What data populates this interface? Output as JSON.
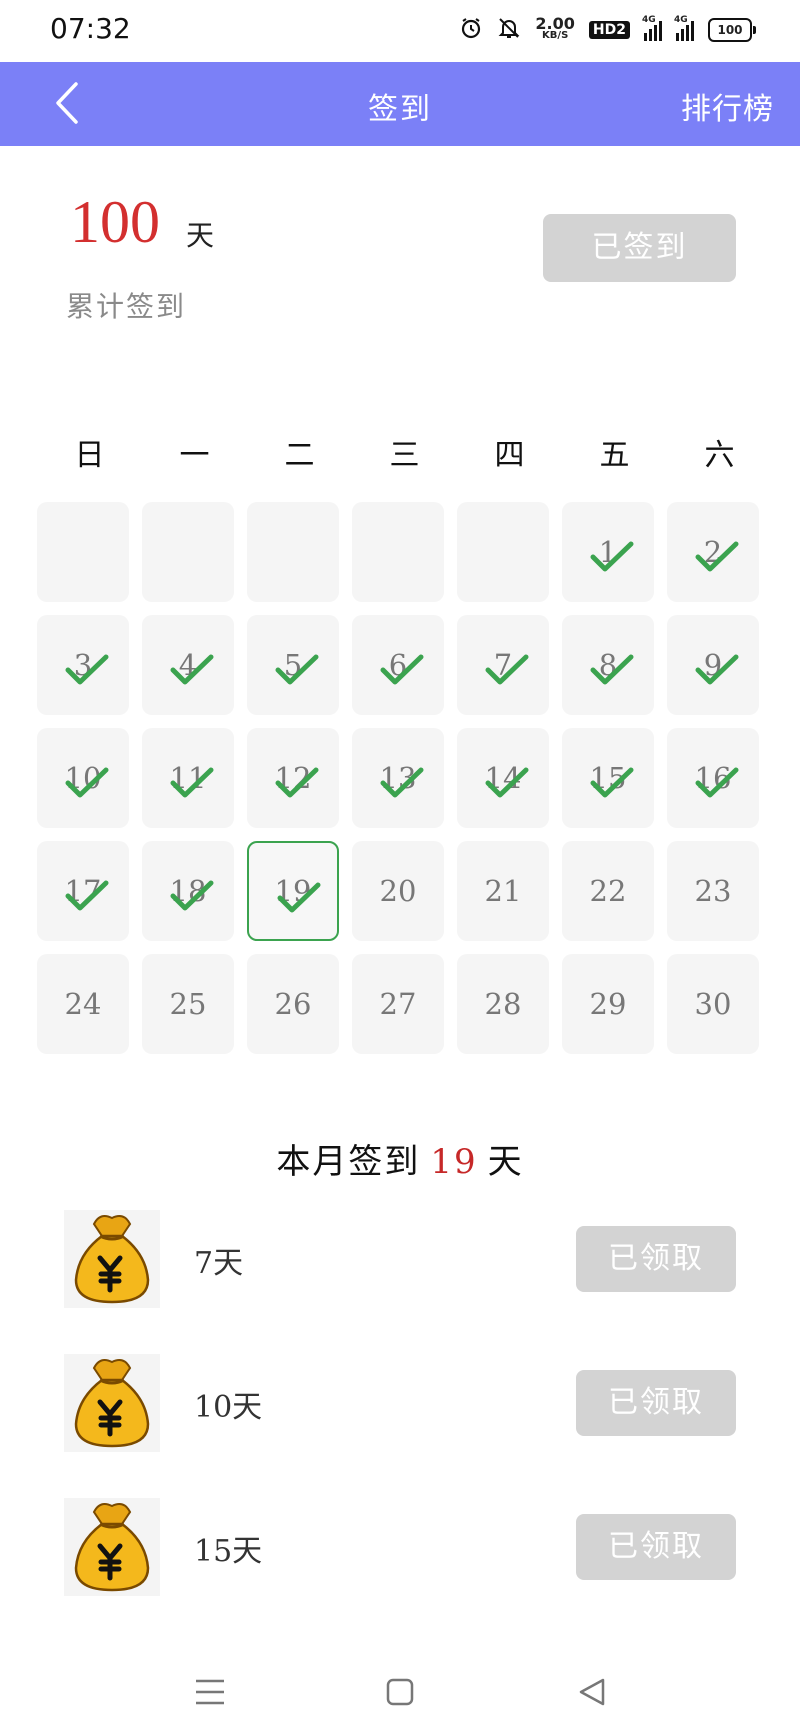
{
  "status_bar": {
    "time": "07:32",
    "speed_value": "2.00",
    "speed_unit": "KB/S",
    "hd_badge": "HD2",
    "net1": "4G",
    "net2": "4G",
    "battery": "100"
  },
  "app_bar": {
    "title": "签到",
    "right_link": "排行榜",
    "accent_color": "#7b80f7"
  },
  "summary": {
    "total_days": "100",
    "unit": "天",
    "caption": "累计签到",
    "signed_button": "已签到"
  },
  "calendar": {
    "weekdays": [
      "日",
      "一",
      "二",
      "三",
      "四",
      "五",
      "六"
    ],
    "leading_blanks": 5,
    "days": [
      {
        "n": "1",
        "checked": true
      },
      {
        "n": "2",
        "checked": true
      },
      {
        "n": "3",
        "checked": true
      },
      {
        "n": "4",
        "checked": true
      },
      {
        "n": "5",
        "checked": true
      },
      {
        "n": "6",
        "checked": true
      },
      {
        "n": "7",
        "checked": true
      },
      {
        "n": "8",
        "checked": true
      },
      {
        "n": "9",
        "checked": true
      },
      {
        "n": "10",
        "checked": true
      },
      {
        "n": "11",
        "checked": true
      },
      {
        "n": "12",
        "checked": true
      },
      {
        "n": "13",
        "checked": true
      },
      {
        "n": "14",
        "checked": true
      },
      {
        "n": "15",
        "checked": true
      },
      {
        "n": "16",
        "checked": true
      },
      {
        "n": "17",
        "checked": true
      },
      {
        "n": "18",
        "checked": true
      },
      {
        "n": "19",
        "checked": true,
        "today": true
      },
      {
        "n": "20",
        "checked": false
      },
      {
        "n": "21",
        "checked": false
      },
      {
        "n": "22",
        "checked": false
      },
      {
        "n": "23",
        "checked": false
      },
      {
        "n": "24",
        "checked": false
      },
      {
        "n": "25",
        "checked": false
      },
      {
        "n": "26",
        "checked": false
      },
      {
        "n": "27",
        "checked": false
      },
      {
        "n": "28",
        "checked": false
      },
      {
        "n": "29",
        "checked": false
      },
      {
        "n": "30",
        "checked": false
      }
    ],
    "check_color": "#3ba34f"
  },
  "month_summary": {
    "prefix": "本月签到",
    "count": "19",
    "suffix": "天"
  },
  "rewards": [
    {
      "label": "7天",
      "button": "已领取",
      "icon": "money-bag-icon"
    },
    {
      "label": "10天",
      "button": "已领取",
      "icon": "money-bag-icon"
    },
    {
      "label": "15天",
      "button": "已领取",
      "icon": "money-bag-icon"
    }
  ],
  "nav": {
    "icons": [
      "menu-icon",
      "home-square-icon",
      "back-triangle-icon"
    ]
  }
}
